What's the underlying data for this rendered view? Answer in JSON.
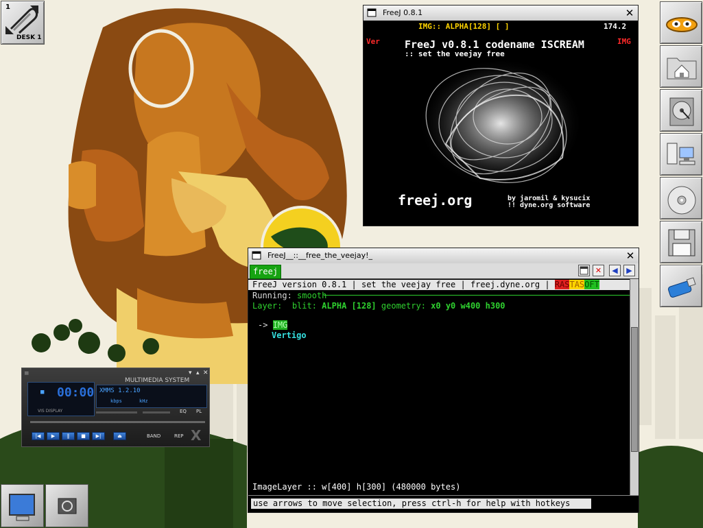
{
  "pager": {
    "number": "1",
    "label": "DESK 1"
  },
  "dock": {
    "items": [
      {
        "name": "gnustep-logo-icon"
      },
      {
        "name": "home-folder-icon"
      },
      {
        "name": "hard-disk-icon"
      },
      {
        "name": "network-computers-icon"
      },
      {
        "name": "cdrom-icon"
      },
      {
        "name": "floppy-disk-icon"
      },
      {
        "name": "usb-drive-icon"
      }
    ]
  },
  "video_window": {
    "title": "FreeJ 0.8.1",
    "osd_top": "IMG::  ALPHA[128] [ ]",
    "fps": "174.2",
    "ver_tag": "Ver",
    "img_tag": "IMG",
    "headline": "FreeJ v0.8.1 codename ISCREAM",
    "subline": ":: set the veejay free",
    "site": "freej.org",
    "credits_1": "by jaromil & kysucix",
    "credits_2": "!! dyne.org software"
  },
  "console_window": {
    "title": "FreeJ__::__free_the_veejay!_",
    "tab_label": "freej",
    "header": {
      "version": "FreeJ version 0.8.1",
      "slogan": "set the veejay free",
      "site": "freej.dyne.org",
      "rasta_1": "RAS",
      "rasta_2": "TAS",
      "rasta_3": "OFT"
    },
    "running_label": "Running:",
    "running_value": "smooth",
    "layer_label": "Layer:",
    "blit_label": "blit:",
    "blit_value": "ALPHA [128]",
    "geometry_label": "geometry:",
    "geometry_value": "x0 y0 w400 h300",
    "arrow": "->",
    "layer_selected": "IMG",
    "filter": "Vertigo",
    "status_line": "ImageLayer :: w[400] h[300] (480000 bytes)",
    "command_hint": "use arrows to move selection, press ctrl-h for help with hotkeys"
  },
  "xmms": {
    "title": "MULTIMEDIA SYSTEM",
    "time": "00:00",
    "track": "XMMS 1.2.10",
    "kbps": "kbps",
    "khz": "kHz",
    "eq": "EQ",
    "pl": "PL",
    "vis_label": "VIS DISPLAY",
    "band": "BAND",
    "rep": "REP"
  },
  "colors": {
    "terminal_green": "#2fd12f",
    "osd_yellow": "#ffd400",
    "osd_red": "#ff2a2a",
    "cyan": "#35e0e0"
  }
}
